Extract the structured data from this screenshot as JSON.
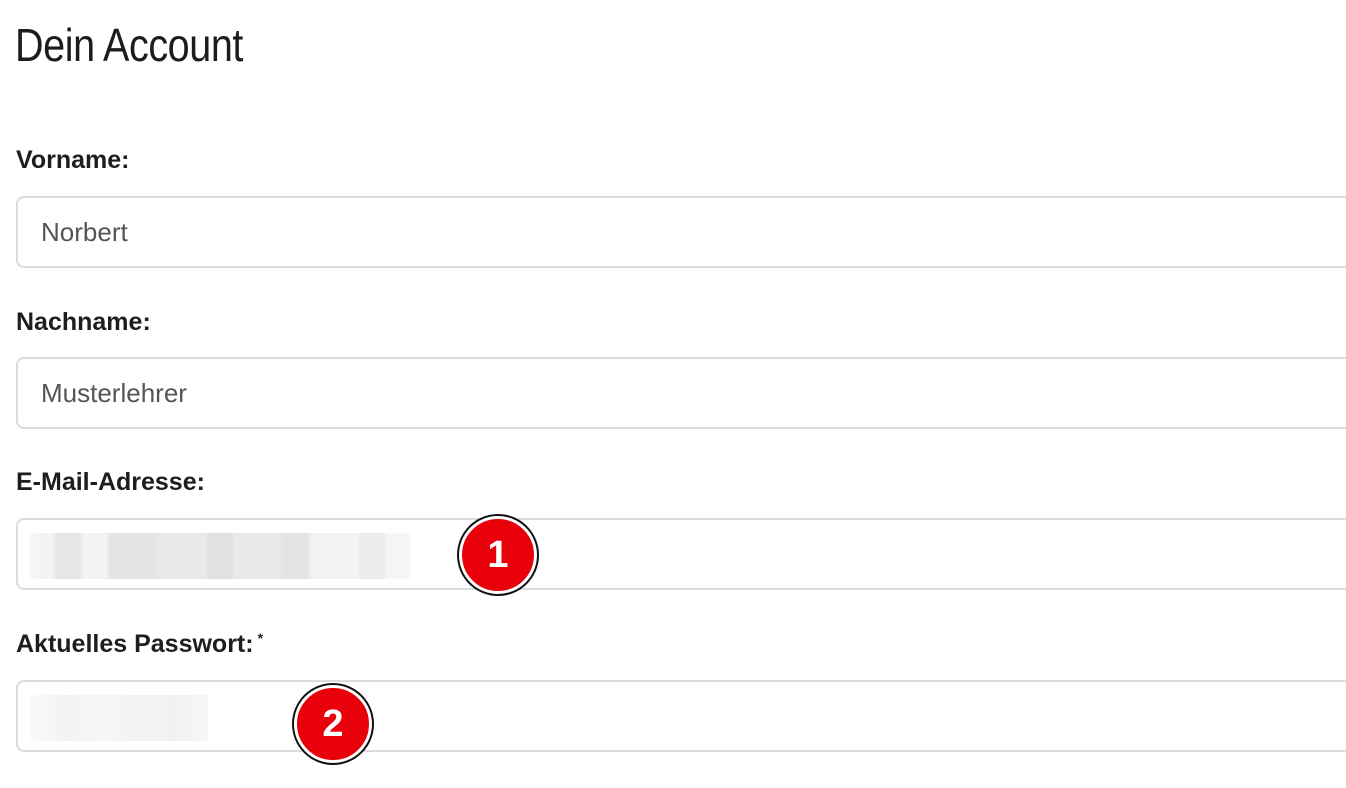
{
  "page": {
    "title": "Dein Account"
  },
  "form": {
    "first_name": {
      "label": "Vorname:",
      "value": "Norbert"
    },
    "last_name": {
      "label": "Nachname:",
      "value": "Musterlehrer"
    },
    "email": {
      "label": "E-Mail-Adresse:",
      "value": ""
    },
    "current_password": {
      "label": "Aktuelles Passwort:",
      "required_mark": "*",
      "value": ""
    }
  },
  "annotations": {
    "marker_1": "1",
    "marker_2": "2",
    "color": "#e8000b"
  }
}
